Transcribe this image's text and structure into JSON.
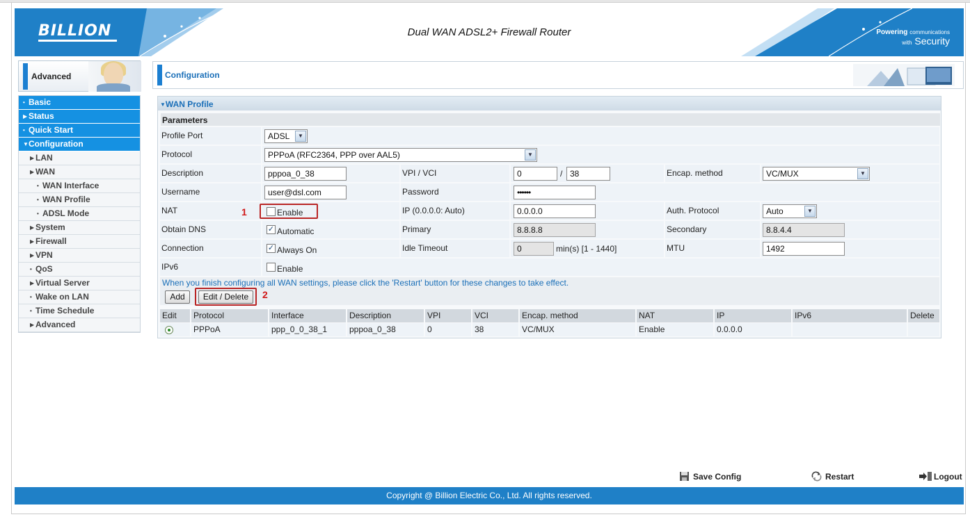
{
  "header": {
    "logo": "BILLION",
    "title": "Dual WAN ADSL2+ Firewall Router",
    "tagline_powering": "Powering",
    "tagline_communications": "communications",
    "tagline_with": "with",
    "tagline_security": "Security"
  },
  "sidebar": {
    "heading": "Advanced",
    "items": [
      {
        "label": "Basic",
        "level": "top"
      },
      {
        "label": "Status",
        "level": "top"
      },
      {
        "label": "Quick Start",
        "level": "top"
      },
      {
        "label": "Configuration",
        "level": "top"
      },
      {
        "label": "LAN",
        "level": "sub"
      },
      {
        "label": "WAN",
        "level": "sub"
      },
      {
        "label": "WAN Interface",
        "level": "sub2"
      },
      {
        "label": "WAN Profile",
        "level": "sub2"
      },
      {
        "label": "ADSL Mode",
        "level": "sub2"
      },
      {
        "label": "System",
        "level": "sub"
      },
      {
        "label": "Firewall",
        "level": "sub"
      },
      {
        "label": "VPN",
        "level": "sub"
      },
      {
        "label": "QoS",
        "level": "sub"
      },
      {
        "label": "Virtual Server",
        "level": "sub"
      },
      {
        "label": "Wake on LAN",
        "level": "sub"
      },
      {
        "label": "Time Schedule",
        "level": "sub"
      },
      {
        "label": "Advanced",
        "level": "sub"
      }
    ]
  },
  "main": {
    "title": "Configuration",
    "panel_title": "WAN Profile",
    "params_label": "Parameters",
    "form": {
      "profile_port_label": "Profile Port",
      "profile_port_value": "ADSL",
      "protocol_label": "Protocol",
      "protocol_value": "PPPoA (RFC2364, PPP over AAL5)",
      "description_label": "Description",
      "description_value": "pppoa_0_38",
      "vpi_vci_label": "VPI / VCI",
      "vpi_value": "0",
      "vci_sep": "/",
      "vci_value": "38",
      "encap_label": "Encap. method",
      "encap_value": "VC/MUX",
      "username_label": "Username",
      "username_value": "user@dsl.com",
      "password_label": "Password",
      "password_value": "••••••",
      "nat_label": "NAT",
      "nat_checkbox_label": "Enable",
      "ip_label": "IP (0.0.0.0: Auto)",
      "ip_value": "0.0.0.0",
      "auth_label": "Auth. Protocol",
      "auth_value": "Auto",
      "obtain_dns_label": "Obtain DNS",
      "obtain_dns_checkbox_label": "Automatic",
      "primary_label": "Primary",
      "primary_value": "8.8.8.8",
      "secondary_label": "Secondary",
      "secondary_value": "8.8.4.4",
      "connection_label": "Connection",
      "connection_checkbox_label": "Always On",
      "idle_label": "Idle Timeout",
      "idle_value": "0",
      "idle_unit": "min(s) [1 - 1440]",
      "mtu_label": "MTU",
      "mtu_value": "1492",
      "ipv6_label": "IPv6",
      "ipv6_checkbox_label": "Enable",
      "check_mark": "✓"
    },
    "note": "When you finish configuring all WAN settings, please click the 'Restart' button for these changes to take effect.",
    "add_button": "Add",
    "edit_delete_button": "Edit / Delete",
    "annotation_1": "1",
    "annotation_2": "2",
    "table": {
      "headers": [
        "Edit",
        "Protocol",
        "Interface",
        "Description",
        "VPI",
        "VCI",
        "Encap. method",
        "NAT",
        "IP",
        "IPv6",
        "Delete"
      ],
      "row": {
        "protocol": "PPPoA",
        "interface": "ppp_0_0_38_1",
        "description": "pppoa_0_38",
        "vpi": "0",
        "vci": "38",
        "encap": "VC/MUX",
        "nat": "Enable",
        "ip": "0.0.0.0",
        "ipv6": "",
        "delete": ""
      }
    }
  },
  "footer": {
    "save_config": "Save Config",
    "restart": "Restart",
    "logout": "Logout",
    "copyright": "Copyright @ Billion Electric Co., Ltd. All rights reserved."
  },
  "colors": {
    "brand_blue": "#1f80c7",
    "menu_blue": "#1591e2",
    "annotation_red": "#b92424"
  }
}
